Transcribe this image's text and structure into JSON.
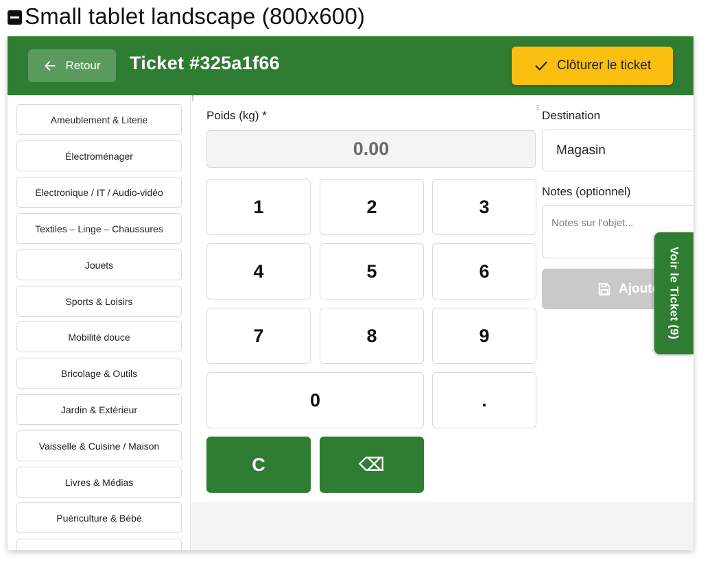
{
  "heading": {
    "title": "Small tablet landscape (800x600)"
  },
  "topbar": {
    "back_label": "Retour",
    "ticket_title": "Ticket #325a1f66",
    "close_label": "Clôturer le ticket"
  },
  "categories": [
    "Ameublement & Literie",
    "Électroménager",
    "Électronique / IT / Audio-vidéo",
    "Textiles – Linge – Chaussures",
    "Jouets",
    "Sports & Loisirs",
    "Mobilité douce",
    "Bricolage & Outils",
    "Jardin & Extérieur",
    "Vaisselle & Cuisine / Maison",
    "Livres & Médias",
    "Puériculture & Bébé",
    ""
  ],
  "weight": {
    "label": "Poids (kg) *",
    "value": "0.00"
  },
  "keypad": {
    "k1": "1",
    "k2": "2",
    "k3": "3",
    "k4": "4",
    "k5": "5",
    "k6": "6",
    "k7": "7",
    "k8": "8",
    "k9": "9",
    "k0": "0",
    "dot": ".",
    "clear": "C",
    "backspace": "⌫"
  },
  "destination": {
    "label": "Destination",
    "value": "Magasin"
  },
  "notes": {
    "label": "Notes (optionnel)",
    "placeholder": "Notes sur l'objet..."
  },
  "add_button": {
    "label": "Ajoute"
  },
  "ticket_tab": {
    "label": "Voir le Ticket (9)"
  },
  "colors": {
    "primary_green": "#2e7d32",
    "accent_yellow": "#fbbf0f",
    "disabled_gray": "#c9c9c9"
  }
}
